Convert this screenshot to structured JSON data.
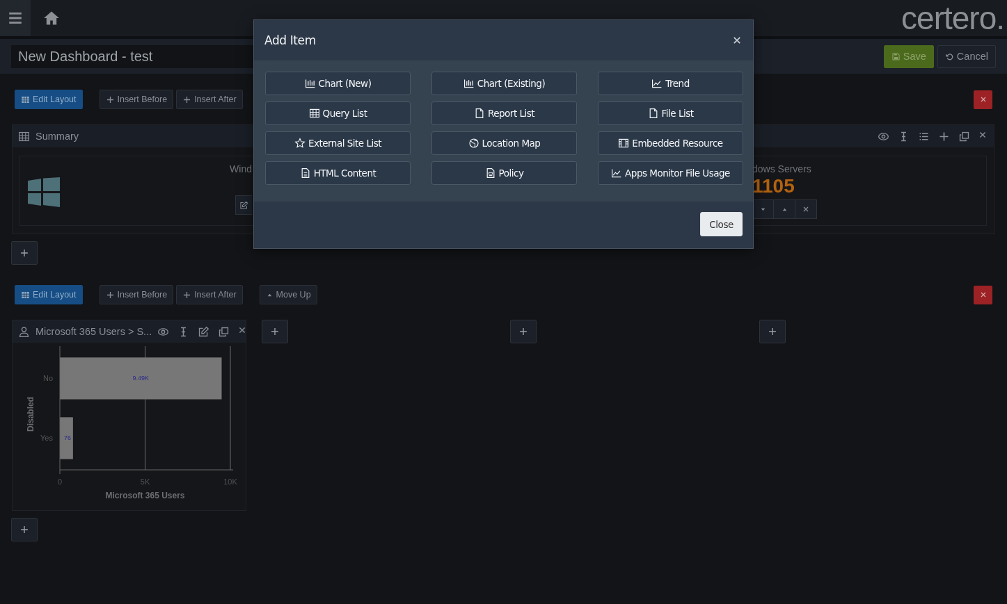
{
  "topbar": {
    "logo": "certero."
  },
  "dashboard": {
    "title": "New Dashboard - test",
    "buttons": [
      {
        "label": "Save",
        "kind": "save"
      },
      {
        "label": "Cancel",
        "kind": "cancel"
      }
    ]
  },
  "row_1": {
    "toolbar": [
      {
        "label": "Edit Layout",
        "kind": "edit"
      },
      {
        "label": "Insert Before",
        "kind": "insert"
      },
      {
        "label": "Insert After",
        "kind": "insert"
      }
    ],
    "panel": {
      "title": "Summary",
      "tile": {
        "left_label": "Wind",
        "right_label": "dows Servers",
        "value": "1105"
      }
    }
  },
  "row_2": {
    "toolbar": [
      {
        "label": "Edit Layout",
        "kind": "edit"
      },
      {
        "label": "Insert Before",
        "kind": "insert"
      },
      {
        "label": "Insert After",
        "kind": "insert"
      },
      {
        "label": "Move Up",
        "kind": "move"
      }
    ],
    "widget": {
      "title": "Microsoft 365 Users > S...",
      "chart_data": {
        "type": "bar",
        "orientation": "horizontal",
        "categories": [
          "No",
          "Yes"
        ],
        "values": [
          9490,
          770
        ],
        "xlabel": "Microsoft 365 Users",
        "ylabel": "Disabled",
        "xlim": [
          0,
          10000
        ],
        "xticks": [
          {
            "value": 0,
            "label": "0"
          },
          {
            "value": 5000,
            "label": "5K"
          },
          {
            "value": 10000,
            "label": "10K"
          }
        ],
        "value_labels": [
          "9.49K",
          null
        ],
        "annotations": [
          {
            "text": "76",
            "x": 0,
            "y": "Yes"
          }
        ]
      }
    }
  },
  "modal": {
    "title": "Add Item",
    "items": [
      {
        "label": "Chart (New)",
        "kind": "chart"
      },
      {
        "label": "Chart (Existing)",
        "kind": "chart"
      },
      {
        "label": "Trend",
        "kind": "trend"
      },
      {
        "label": "Query List",
        "kind": "table"
      },
      {
        "label": "Report List",
        "kind": "file"
      },
      {
        "label": "File List",
        "kind": "file"
      },
      {
        "label": "External Site List",
        "kind": "star"
      },
      {
        "label": "Location Map",
        "kind": "globe"
      },
      {
        "label": "Embedded Resource",
        "kind": "film"
      },
      {
        "label": "HTML Content",
        "kind": "document"
      },
      {
        "label": "Policy",
        "kind": "policy"
      },
      {
        "label": "Apps Monitor File Usage",
        "kind": "trend"
      }
    ],
    "close_button": "Close"
  }
}
